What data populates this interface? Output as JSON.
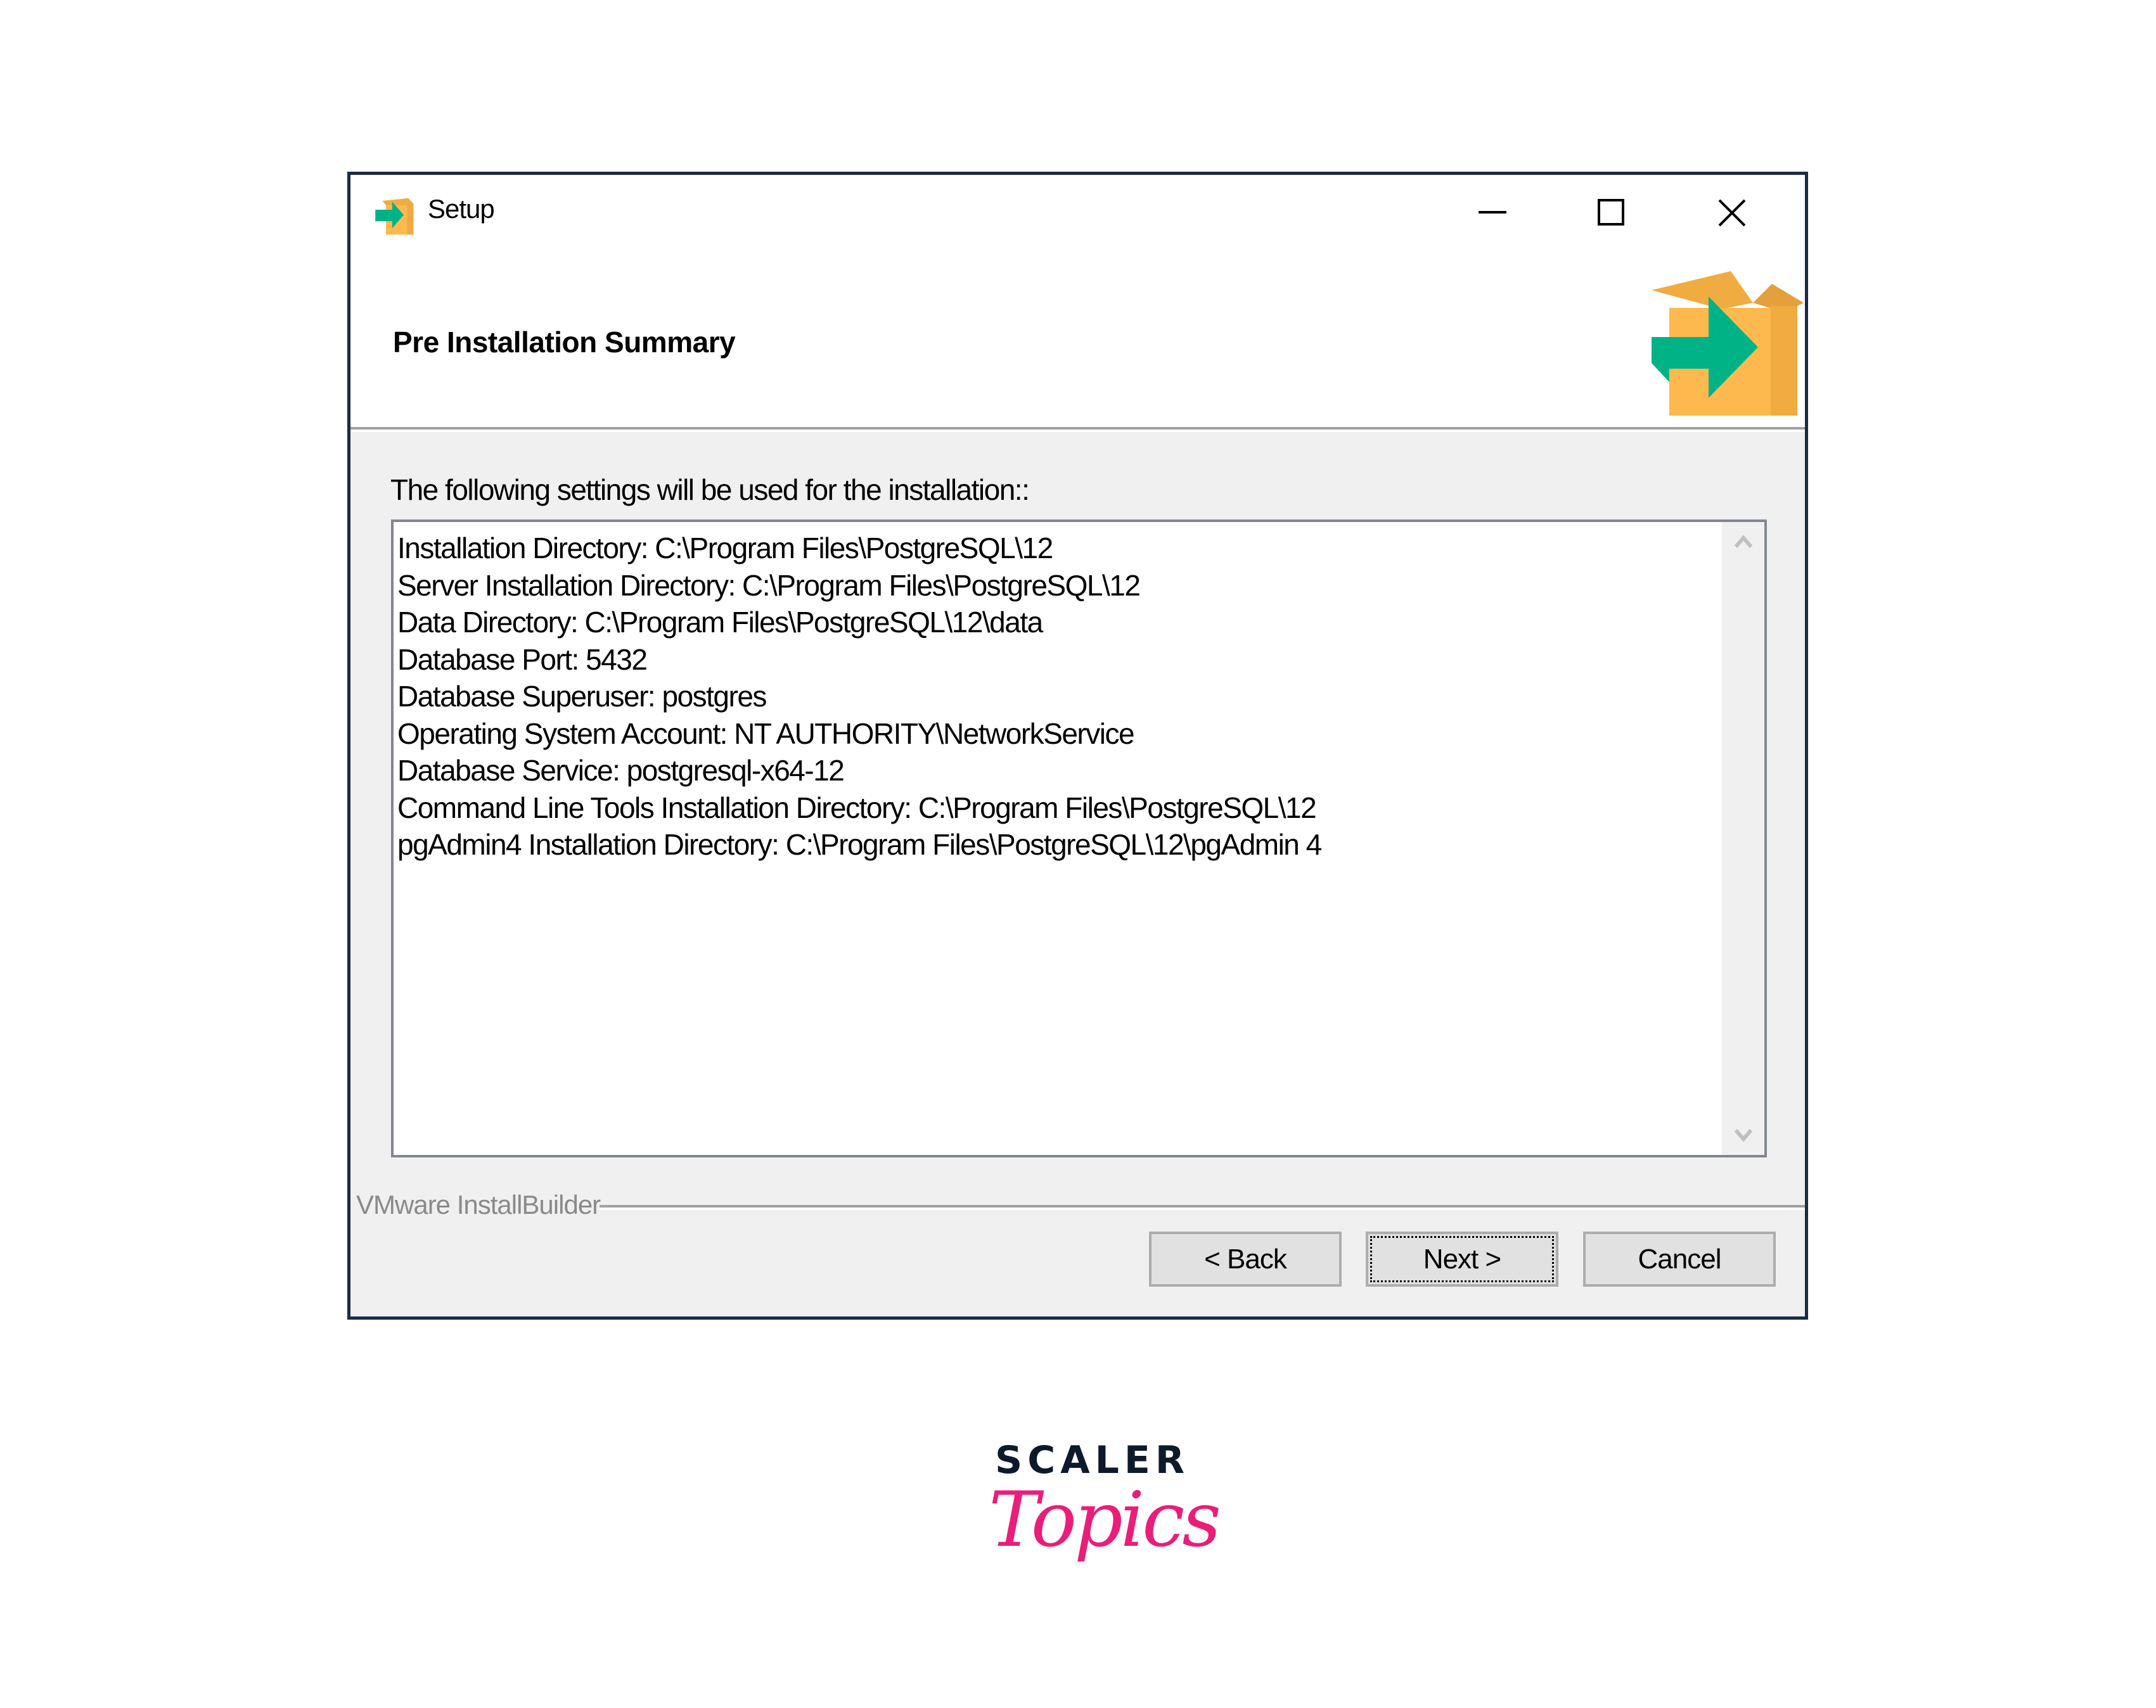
{
  "window": {
    "title": "Setup",
    "app_icon": "installer-box-icon",
    "controls": {
      "minimize_icon": "minimize-icon",
      "maximize_icon": "maximize-icon",
      "close_icon": "close-icon"
    }
  },
  "header": {
    "heading": "Pre Installation Summary",
    "logo_icon": "installer-box-icon"
  },
  "body": {
    "intro": "The following settings will be used for the installation::",
    "summary_lines": [
      "Installation Directory: C:\\Program Files\\PostgreSQL\\12",
      "Server Installation Directory: C:\\Program Files\\PostgreSQL\\12",
      "Data Directory: C:\\Program Files\\PostgreSQL\\12\\data",
      "Database Port: 5432",
      "Database Superuser: postgres",
      "Operating System Account: NT AUTHORITY\\NetworkService",
      "Database Service: postgresql-x64-12",
      "Command Line Tools Installation Directory: C:\\Program Files\\PostgreSQL\\12",
      "pgAdmin4 Installation Directory: C:\\Program Files\\PostgreSQL\\12\\pgAdmin 4"
    ]
  },
  "footer": {
    "branding": "VMware InstallBuilder",
    "buttons": {
      "back": "< Back",
      "next": "Next >",
      "cancel": "Cancel"
    }
  },
  "watermark": {
    "line1": "SCALER",
    "line2": "Topics"
  },
  "colors": {
    "window_border": "#1b2a48",
    "dialog_bg": "#f0f0f0",
    "arrow_green": "#00b386",
    "box_orange": "#fdb94e",
    "brand_navy": "#0c1a2b",
    "brand_pink": "#e91e7a"
  }
}
